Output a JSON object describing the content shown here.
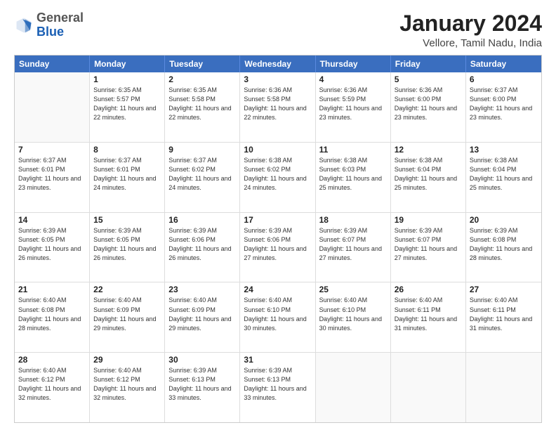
{
  "logo": {
    "general": "General",
    "blue": "Blue"
  },
  "title": "January 2024",
  "subtitle": "Vellore, Tamil Nadu, India",
  "days": [
    "Sunday",
    "Monday",
    "Tuesday",
    "Wednesday",
    "Thursday",
    "Friday",
    "Saturday"
  ],
  "weeks": [
    [
      {
        "day": "",
        "empty": true
      },
      {
        "day": "1",
        "sunrise": "6:35 AM",
        "sunset": "5:57 PM",
        "daylight": "11 hours and 22 minutes."
      },
      {
        "day": "2",
        "sunrise": "6:35 AM",
        "sunset": "5:58 PM",
        "daylight": "11 hours and 22 minutes."
      },
      {
        "day": "3",
        "sunrise": "6:36 AM",
        "sunset": "5:58 PM",
        "daylight": "11 hours and 22 minutes."
      },
      {
        "day": "4",
        "sunrise": "6:36 AM",
        "sunset": "5:59 PM",
        "daylight": "11 hours and 23 minutes."
      },
      {
        "day": "5",
        "sunrise": "6:36 AM",
        "sunset": "6:00 PM",
        "daylight": "11 hours and 23 minutes."
      },
      {
        "day": "6",
        "sunrise": "6:37 AM",
        "sunset": "6:00 PM",
        "daylight": "11 hours and 23 minutes."
      }
    ],
    [
      {
        "day": "7",
        "sunrise": "6:37 AM",
        "sunset": "6:01 PM",
        "daylight": "11 hours and 23 minutes."
      },
      {
        "day": "8",
        "sunrise": "6:37 AM",
        "sunset": "6:01 PM",
        "daylight": "11 hours and 24 minutes."
      },
      {
        "day": "9",
        "sunrise": "6:37 AM",
        "sunset": "6:02 PM",
        "daylight": "11 hours and 24 minutes."
      },
      {
        "day": "10",
        "sunrise": "6:38 AM",
        "sunset": "6:02 PM",
        "daylight": "11 hours and 24 minutes."
      },
      {
        "day": "11",
        "sunrise": "6:38 AM",
        "sunset": "6:03 PM",
        "daylight": "11 hours and 25 minutes."
      },
      {
        "day": "12",
        "sunrise": "6:38 AM",
        "sunset": "6:04 PM",
        "daylight": "11 hours and 25 minutes."
      },
      {
        "day": "13",
        "sunrise": "6:38 AM",
        "sunset": "6:04 PM",
        "daylight": "11 hours and 25 minutes."
      }
    ],
    [
      {
        "day": "14",
        "sunrise": "6:39 AM",
        "sunset": "6:05 PM",
        "daylight": "11 hours and 26 minutes."
      },
      {
        "day": "15",
        "sunrise": "6:39 AM",
        "sunset": "6:05 PM",
        "daylight": "11 hours and 26 minutes."
      },
      {
        "day": "16",
        "sunrise": "6:39 AM",
        "sunset": "6:06 PM",
        "daylight": "11 hours and 26 minutes."
      },
      {
        "day": "17",
        "sunrise": "6:39 AM",
        "sunset": "6:06 PM",
        "daylight": "11 hours and 27 minutes."
      },
      {
        "day": "18",
        "sunrise": "6:39 AM",
        "sunset": "6:07 PM",
        "daylight": "11 hours and 27 minutes."
      },
      {
        "day": "19",
        "sunrise": "6:39 AM",
        "sunset": "6:07 PM",
        "daylight": "11 hours and 27 minutes."
      },
      {
        "day": "20",
        "sunrise": "6:39 AM",
        "sunset": "6:08 PM",
        "daylight": "11 hours and 28 minutes."
      }
    ],
    [
      {
        "day": "21",
        "sunrise": "6:40 AM",
        "sunset": "6:08 PM",
        "daylight": "11 hours and 28 minutes."
      },
      {
        "day": "22",
        "sunrise": "6:40 AM",
        "sunset": "6:09 PM",
        "daylight": "11 hours and 29 minutes."
      },
      {
        "day": "23",
        "sunrise": "6:40 AM",
        "sunset": "6:09 PM",
        "daylight": "11 hours and 29 minutes."
      },
      {
        "day": "24",
        "sunrise": "6:40 AM",
        "sunset": "6:10 PM",
        "daylight": "11 hours and 30 minutes."
      },
      {
        "day": "25",
        "sunrise": "6:40 AM",
        "sunset": "6:10 PM",
        "daylight": "11 hours and 30 minutes."
      },
      {
        "day": "26",
        "sunrise": "6:40 AM",
        "sunset": "6:11 PM",
        "daylight": "11 hours and 31 minutes."
      },
      {
        "day": "27",
        "sunrise": "6:40 AM",
        "sunset": "6:11 PM",
        "daylight": "11 hours and 31 minutes."
      }
    ],
    [
      {
        "day": "28",
        "sunrise": "6:40 AM",
        "sunset": "6:12 PM",
        "daylight": "11 hours and 32 minutes."
      },
      {
        "day": "29",
        "sunrise": "6:40 AM",
        "sunset": "6:12 PM",
        "daylight": "11 hours and 32 minutes."
      },
      {
        "day": "30",
        "sunrise": "6:39 AM",
        "sunset": "6:13 PM",
        "daylight": "11 hours and 33 minutes."
      },
      {
        "day": "31",
        "sunrise": "6:39 AM",
        "sunset": "6:13 PM",
        "daylight": "11 hours and 33 minutes."
      },
      {
        "day": "",
        "empty": true
      },
      {
        "day": "",
        "empty": true
      },
      {
        "day": "",
        "empty": true
      }
    ]
  ]
}
